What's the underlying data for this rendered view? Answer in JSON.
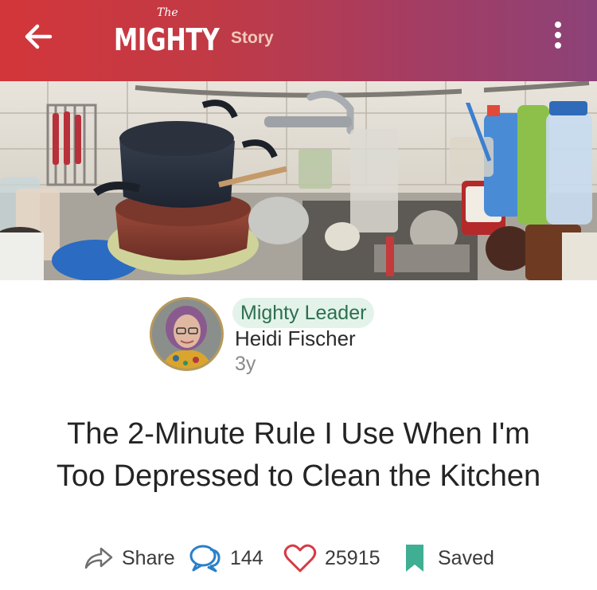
{
  "header": {
    "logo_small": "The",
    "logo_main": "MIGHTY",
    "section": "Story",
    "back_icon": "arrow-left-icon",
    "menu_icon": "kebab-menu-icon",
    "colors": {
      "gradient_start": "#d3363a",
      "gradient_end": "#8c4278"
    }
  },
  "hero": {
    "description_icon": "hero-photo"
  },
  "author": {
    "badge": "Mighty Leader",
    "name": "Heidi Fischer",
    "time": "3y"
  },
  "article": {
    "title_line1": "The 2-Minute Rule I Use When I'm",
    "title_line2": "Too Depressed to Clean the Kitchen"
  },
  "actions": {
    "share_label": "Share",
    "comments_count": "144",
    "likes_count": "25915",
    "saved_label": "Saved",
    "colors": {
      "comment": "#2a7fc9",
      "heart": "#d73a45",
      "bookmark": "#3fae93"
    }
  }
}
